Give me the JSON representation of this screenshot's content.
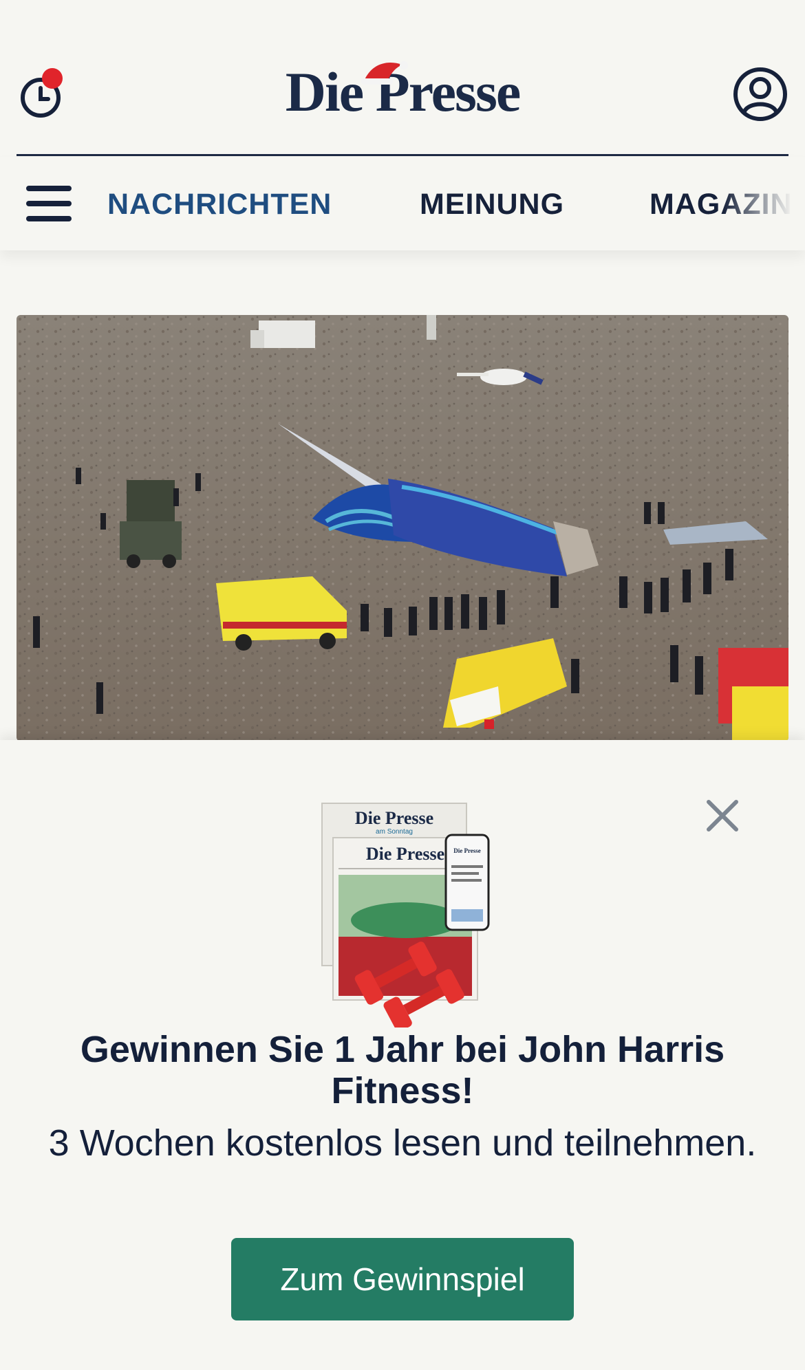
{
  "header": {
    "logo_text": "Die Presse",
    "history_label": "",
    "account_label": ""
  },
  "nav": {
    "items": [
      {
        "label": "NACHRICHTEN",
        "active": true
      },
      {
        "label": "MEINUNG",
        "active": false
      },
      {
        "label": "MAGAZIN",
        "active": false
      }
    ]
  },
  "hero": {
    "subject": "aerial photo of crashed passenger aircraft with ambulances and rescue crews in a steppe field"
  },
  "promo": {
    "newspaper_title_1": "Die Presse",
    "newspaper_subtitle_1": "am Sonntag",
    "newspaper_title_2": "Die Presse",
    "phone_title": "Die Presse",
    "headline": "Gewinnen Sie 1 Jahr bei John Harris Fitness!",
    "subline": "3 Wochen kostenlos lesen und teilnehmen.",
    "cta_label": "Zum Gewinnspiel"
  },
  "colors": {
    "background": "#f6f6f2",
    "navy": "#16213a",
    "nav_active": "#1f4d80",
    "cta": "#247c64",
    "notification_dot": "#e0242b"
  },
  "icons": {
    "history": "clock-icon",
    "account": "user-icon",
    "menu": "hamburger-icon",
    "close": "close-icon"
  }
}
